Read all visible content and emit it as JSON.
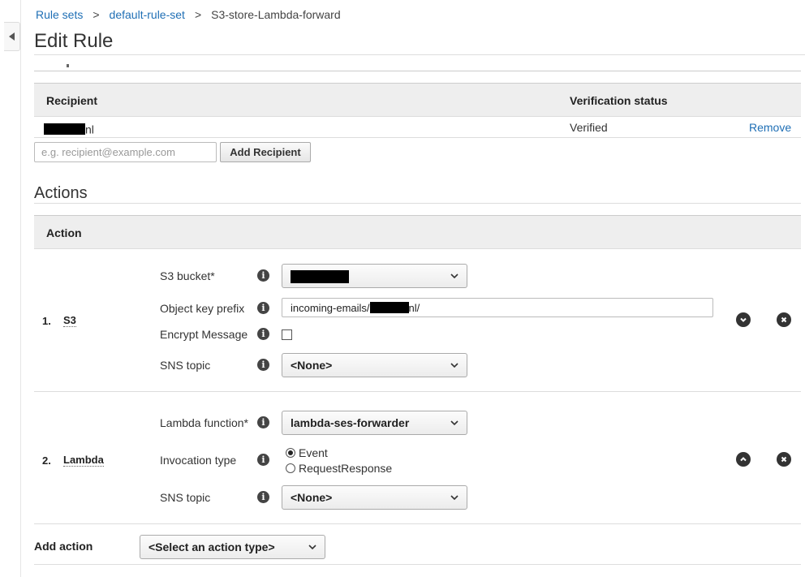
{
  "breadcrumb": {
    "items": [
      "Rule sets",
      "default-rule-set"
    ],
    "separator": ">",
    "current": "S3-store-Lambda-forward"
  },
  "page_title": "Edit Rule",
  "recipients": {
    "col_recipient": "Recipient",
    "col_status": "Verification status",
    "rows": [
      {
        "suffix": "nl",
        "status": "Verified",
        "remove": "Remove"
      }
    ],
    "input_placeholder": "e.g. recipient@example.com",
    "add_button": "Add Recipient"
  },
  "actions": {
    "title": "Actions",
    "col_action": "Action",
    "s3": {
      "num": "1.",
      "name": "S3",
      "bucket_label": "S3 bucket*",
      "prefix_label": "Object key prefix",
      "prefix_start": "incoming-emails/",
      "prefix_end": "nl/",
      "encrypt_label": "Encrypt Message",
      "sns_label": "SNS topic",
      "sns_value": "<None>"
    },
    "lambda": {
      "num": "2.",
      "name": "Lambda",
      "function_label": "Lambda function*",
      "function_value": "lambda-ses-forwarder",
      "invocation_label": "Invocation type",
      "invocation_options": [
        "Event",
        "RequestResponse"
      ],
      "invocation_selected": "Event",
      "sns_label": "SNS topic",
      "sns_value": "<None>"
    },
    "add_action_label": "Add action",
    "add_action_select": "<Select an action type>"
  },
  "icons": {
    "info": "i"
  },
  "colors": {
    "link": "#1f6fb5",
    "header_bg": "#eeeeee",
    "redaction": "#000000"
  }
}
